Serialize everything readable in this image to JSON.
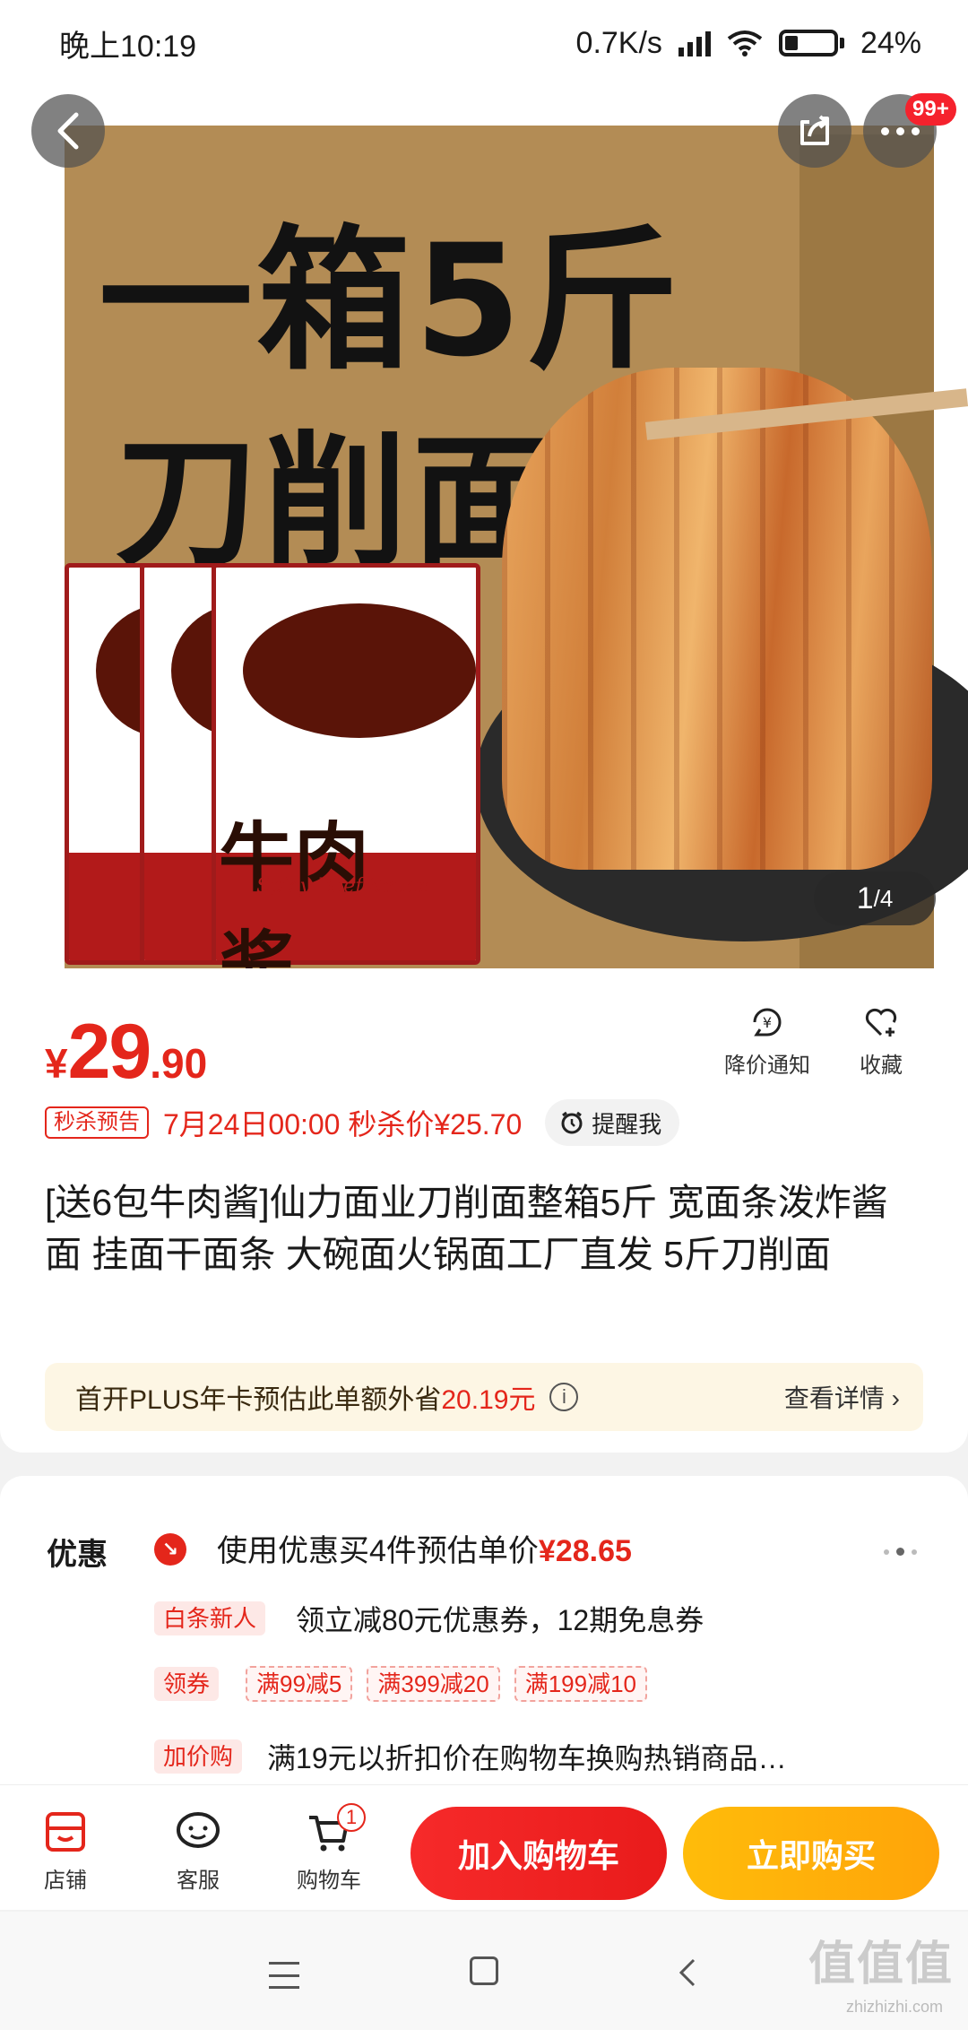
{
  "status_bar": {
    "time": "晚上10:19",
    "net_speed": "0.7K/s",
    "battery": "24%",
    "battery_level": 0.24
  },
  "hero": {
    "image_text_1": "一箱5斤",
    "image_text_2": "刀削面",
    "packet_label": "牛肉酱",
    "packet_sub": "Spicy Beef Sauce",
    "more_badge": "99+",
    "pager_current": "1",
    "pager_total": "/4"
  },
  "price": {
    "currency": "¥",
    "integer": "29",
    "decimal": ".90"
  },
  "actions": {
    "price_notify": "降价通知",
    "favorite": "收藏"
  },
  "flash_sale": {
    "tag": "秒杀预告",
    "text": "7月24日00:00 秒杀价¥25.70",
    "remind": "提醒我"
  },
  "product_title": "[送6包牛肉酱]仙力面业刀削面整箱5斤 宽面条泼炸酱面 挂面干面条 大碗面火锅面工厂直发 5斤刀削面",
  "plus": {
    "text": "首开PLUS年卡预估此单额外省",
    "amount": "20.19元",
    "detail": "查看详情 ›"
  },
  "promo": {
    "label": "优惠",
    "main_text": "使用优惠买4件预估单价",
    "main_amount": "¥28.65",
    "baitiao_tag": "白条新人",
    "baitiao_text": "领立减80元优惠券，12期免息券",
    "coupon_tag": "领券",
    "coupons": [
      "满99减5",
      "满399减20",
      "满199减10"
    ],
    "addon_tag": "加价购",
    "addon_text": "满19元以折扣价在购物车换购热销商品…"
  },
  "bottom_bar": {
    "shop": "店铺",
    "service": "客服",
    "cart": "购物车",
    "cart_count": "1",
    "add_to_cart": "加入购物车",
    "buy_now": "立即购买"
  },
  "watermark": {
    "logo": "值值值",
    "site": "zhizhizhi.com"
  },
  "colors": {
    "accent_red": "#e4261b",
    "buy_orange": "#ffa409"
  }
}
